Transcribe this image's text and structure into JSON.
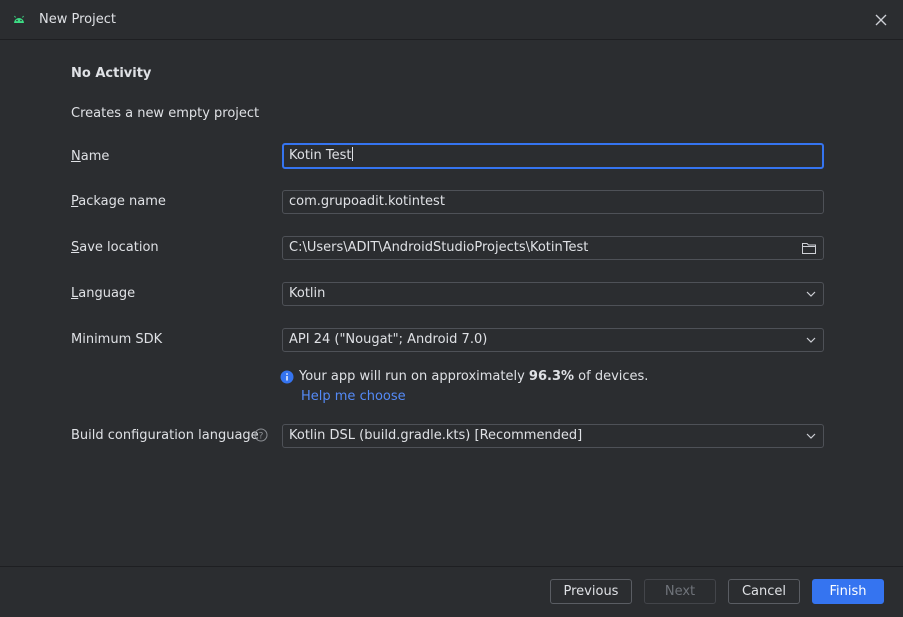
{
  "window": {
    "title": "New Project"
  },
  "template": {
    "heading": "No Activity",
    "description": "Creates a new empty project"
  },
  "form": {
    "name": {
      "label_mnemonic": "N",
      "label_rest": "ame",
      "value": "Kotin Test"
    },
    "package": {
      "label_mnemonic": "P",
      "label_rest": "ackage name",
      "value": "com.grupoadit.kotintest"
    },
    "save_location": {
      "label_mnemonic": "S",
      "label_rest": "ave location",
      "value": "C:\\Users\\ADIT\\AndroidStudioProjects\\KotinTest"
    },
    "language": {
      "label_mnemonic": "L",
      "label_rest": "anguage",
      "value": "Kotlin"
    },
    "min_sdk": {
      "label": "Minimum SDK",
      "value": "API 24 (\"Nougat\"; Android 7.0)"
    },
    "build_config": {
      "label": "Build configuration language",
      "value": "Kotlin DSL (build.gradle.kts) [Recommended]"
    }
  },
  "sdk_info": {
    "prefix": "Your app will run on approximately ",
    "percent": "96.3%",
    "suffix": " of devices.",
    "link": "Help me choose"
  },
  "footer": {
    "previous": "Previous",
    "next": "Next",
    "cancel": "Cancel",
    "finish": "Finish"
  },
  "icons": {
    "title": "android-icon",
    "close": "close-icon",
    "folder": "folder-icon",
    "dropdown": "chevron-down-icon",
    "info": "info-icon",
    "help": "help-icon"
  },
  "colors": {
    "accent": "#3574f0",
    "android_green": "#3ddc84",
    "link": "#548af7",
    "background": "#2b2d30"
  }
}
